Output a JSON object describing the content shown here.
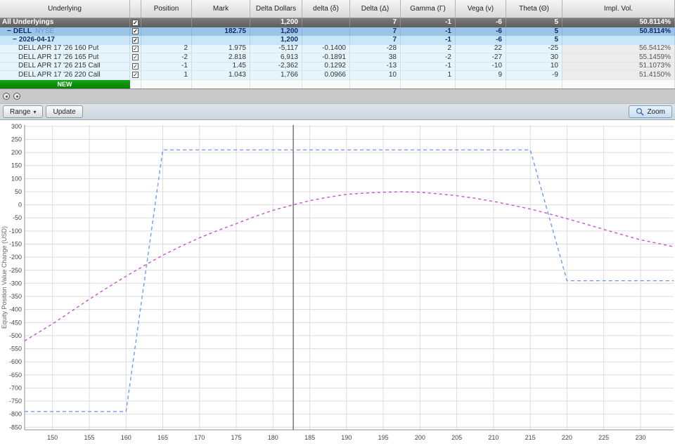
{
  "icons": {
    "check": "✓",
    "caret_down": "▾"
  },
  "table": {
    "columns": [
      {
        "key": "underlying",
        "label": "Underlying"
      },
      {
        "key": "check",
        "label": ""
      },
      {
        "key": "position",
        "label": "Position"
      },
      {
        "key": "mark",
        "label": "Mark"
      },
      {
        "key": "delta_dollars",
        "label": "Delta Dollars"
      },
      {
        "key": "delta_small",
        "label": "delta (δ)"
      },
      {
        "key": "delta_cap",
        "label": "Delta (Δ)"
      },
      {
        "key": "gamma",
        "label": "Gamma (Γ)"
      },
      {
        "key": "vega",
        "label": "Vega (v)"
      },
      {
        "key": "theta",
        "label": "Theta (Θ)"
      },
      {
        "key": "impl_vol",
        "label": "Impl. Vol."
      }
    ],
    "rows": [
      {
        "name": "row-all-underlyings",
        "style": "all",
        "indent": 0,
        "tree": "",
        "label": "All Underlyings",
        "sublabel": "",
        "checkbox": true,
        "values": [
          "",
          "",
          "1,200",
          "",
          "7",
          "-1",
          "-6",
          "5",
          "50.8114%"
        ]
      },
      {
        "name": "row-underlying-dell",
        "style": "underlying",
        "indent": 1,
        "tree": "−",
        "label": "DELL",
        "sublabel": "NYSE",
        "checkbox": true,
        "values": [
          "",
          "182.75",
          "1,200",
          "",
          "7",
          "-1",
          "-6",
          "5",
          "50.8114%"
        ]
      },
      {
        "name": "row-expiry-2026-04-17",
        "style": "expiry",
        "indent": 2,
        "tree": "−",
        "label": "2026-04-17",
        "sublabel": "",
        "checkbox": true,
        "values": [
          "",
          "",
          "1,200",
          "",
          "7",
          "-1",
          "-6",
          "5",
          ""
        ]
      },
      {
        "name": "row-leg-160-put",
        "style": "leg",
        "indent": 3,
        "tree": "",
        "label": "DELL APR 17 '26 160 Put",
        "sublabel": "",
        "checkbox": true,
        "values": [
          "2",
          "1.975",
          "-5,117",
          "-0.1400",
          "-28",
          "2",
          "22",
          "-25",
          "56.5412%"
        ]
      },
      {
        "name": "row-leg-165-put",
        "style": "leg",
        "indent": 3,
        "tree": "",
        "label": "DELL APR 17 '26 165 Put",
        "sublabel": "",
        "checkbox": true,
        "values": [
          "-2",
          "2.818",
          "6,913",
          "-0.1891",
          "38",
          "-2",
          "-27",
          "30",
          "55.1459%"
        ]
      },
      {
        "name": "row-leg-215-call",
        "style": "leg",
        "indent": 3,
        "tree": "",
        "label": "DELL APR 17 '26 215 Call",
        "sublabel": "",
        "checkbox": true,
        "values": [
          "-1",
          "1.45",
          "-2,362",
          "0.1292",
          "-13",
          "-1",
          "-10",
          "10",
          "51.1073%"
        ]
      },
      {
        "name": "row-leg-220-call",
        "style": "leg",
        "indent": 3,
        "tree": "",
        "label": "DELL APR 17 '26 220 Call",
        "sublabel": "",
        "checkbox": true,
        "values": [
          "1",
          "1.043",
          "1,766",
          "0.0966",
          "10",
          "1",
          "9",
          "-9",
          "51.4150%"
        ]
      },
      {
        "name": "row-new",
        "style": "new",
        "indent": 0,
        "tree": "",
        "label": "NEW",
        "sublabel": "",
        "checkbox": false,
        "values": [
          "",
          "",
          "",
          "",
          "",
          "",
          "",
          "",
          ""
        ]
      }
    ]
  },
  "toolbar": {
    "range_label": "Range",
    "update_label": "Update",
    "zoom_label": "Zoom"
  },
  "chart_data": {
    "type": "line",
    "title": "",
    "xlabel": "",
    "ylabel": "Equity Position Value Change (USD)",
    "xlim": [
      146.2,
      234.5
    ],
    "ylim": [
      -860,
      305
    ],
    "xticks": [
      150,
      155,
      160,
      165,
      170,
      175,
      180,
      185,
      190,
      195,
      200,
      205,
      210,
      215,
      220,
      225,
      230
    ],
    "yticks": [
      300,
      250,
      200,
      150,
      100,
      50,
      0,
      -50,
      -100,
      -150,
      -200,
      -250,
      -300,
      -350,
      -400,
      -450,
      -500,
      -550,
      -600,
      -650,
      -700,
      -750,
      -800,
      -850
    ],
    "grid": true,
    "legend_position": "none",
    "price_marker": {
      "x": 182.75,
      "color": "#555555"
    },
    "series": [
      {
        "name": "expiration-pl",
        "color": "#6f9bf5",
        "dash": "5,4",
        "points": [
          [
            146.2,
            -790
          ],
          [
            160,
            -790
          ],
          [
            165,
            210
          ],
          [
            215,
            210
          ],
          [
            220,
            -290
          ],
          [
            234.5,
            -290
          ]
        ]
      },
      {
        "name": "current-pl",
        "color": "#c653cc",
        "dash": "4,4",
        "points": [
          [
            146.2,
            -520
          ],
          [
            150,
            -455
          ],
          [
            152.5,
            -408
          ],
          [
            155,
            -361
          ],
          [
            157.5,
            -316
          ],
          [
            160,
            -273
          ],
          [
            162.5,
            -232
          ],
          [
            165,
            -193
          ],
          [
            167.5,
            -158
          ],
          [
            170,
            -126
          ],
          [
            172.5,
            -98
          ],
          [
            175,
            -72
          ],
          [
            177.5,
            -45
          ],
          [
            180,
            -21
          ],
          [
            182.75,
            0
          ],
          [
            185,
            16
          ],
          [
            187.5,
            29
          ],
          [
            190,
            40
          ],
          [
            192.5,
            45
          ],
          [
            195,
            48
          ],
          [
            197.5,
            50
          ],
          [
            200,
            48
          ],
          [
            202.5,
            42
          ],
          [
            205,
            35
          ],
          [
            207.5,
            25
          ],
          [
            210,
            13
          ],
          [
            212.5,
            -1
          ],
          [
            215,
            -16
          ],
          [
            217.5,
            -34
          ],
          [
            220,
            -53
          ],
          [
            222.5,
            -73
          ],
          [
            225,
            -94
          ],
          [
            227.5,
            -114
          ],
          [
            230,
            -134
          ],
          [
            232.5,
            -148
          ],
          [
            234.5,
            -160
          ]
        ]
      }
    ]
  }
}
